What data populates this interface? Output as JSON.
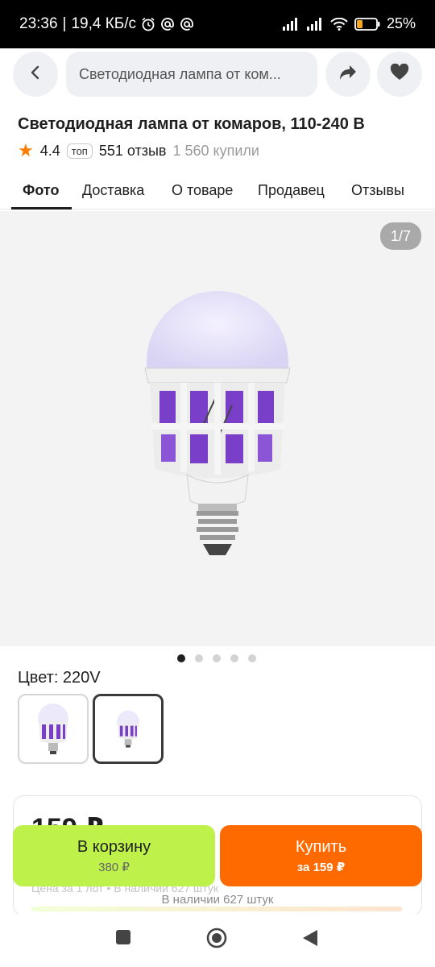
{
  "status_bar": {
    "time": "23:36",
    "network_speed": "19,4 КБ/с",
    "battery": "25"
  },
  "header": {
    "search_text": "Светодиодная лампа от ком..."
  },
  "product": {
    "title": "Светодиодная лампа от комаров, 110-240 В",
    "rating": "4.4",
    "badge": "топ",
    "reviews": "551 отзыв",
    "bought": "1 560 купили"
  },
  "tabs": [
    {
      "label": "Фото",
      "active": true
    },
    {
      "label": "Доставка",
      "active": false
    },
    {
      "label": "О товаре",
      "active": false
    },
    {
      "label": "Продавец",
      "active": false
    },
    {
      "label": "Отзывы",
      "active": false
    }
  ],
  "gallery": {
    "counter": "1/7",
    "dots_total": 5,
    "dot_active": 1
  },
  "color": {
    "label": "Цвет: 220V",
    "options": [
      "220V",
      "220V"
    ],
    "selected_index": 1
  },
  "price_card": {
    "price": "159 ₽",
    "note": "Цена за 1 лот • В наличии 627 штук"
  },
  "actions": {
    "cart_label": "В корзину",
    "cart_sub": "380 ₽",
    "buy_label": "Купить",
    "buy_sub": "за 159 ₽"
  },
  "stock_text": "В наличии 627 штук",
  "colors": {
    "accent_orange": "#ff6a00",
    "cart_green": "#bef24a",
    "star": "#ff7a00"
  }
}
